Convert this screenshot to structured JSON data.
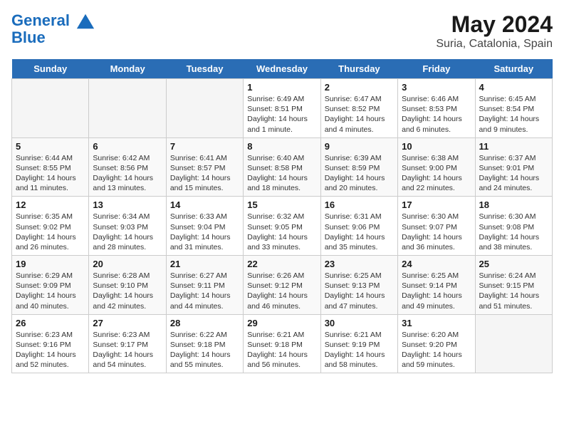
{
  "header": {
    "logo_line1": "General",
    "logo_line2": "Blue",
    "month": "May 2024",
    "location": "Suria, Catalonia, Spain"
  },
  "days_of_week": [
    "Sunday",
    "Monday",
    "Tuesday",
    "Wednesday",
    "Thursday",
    "Friday",
    "Saturday"
  ],
  "weeks": [
    [
      {
        "day": null
      },
      {
        "day": null
      },
      {
        "day": null
      },
      {
        "day": "1",
        "sunrise": "Sunrise: 6:49 AM",
        "sunset": "Sunset: 8:51 PM",
        "daylight": "Daylight: 14 hours and 1 minute."
      },
      {
        "day": "2",
        "sunrise": "Sunrise: 6:47 AM",
        "sunset": "Sunset: 8:52 PM",
        "daylight": "Daylight: 14 hours and 4 minutes."
      },
      {
        "day": "3",
        "sunrise": "Sunrise: 6:46 AM",
        "sunset": "Sunset: 8:53 PM",
        "daylight": "Daylight: 14 hours and 6 minutes."
      },
      {
        "day": "4",
        "sunrise": "Sunrise: 6:45 AM",
        "sunset": "Sunset: 8:54 PM",
        "daylight": "Daylight: 14 hours and 9 minutes."
      }
    ],
    [
      {
        "day": "5",
        "sunrise": "Sunrise: 6:44 AM",
        "sunset": "Sunset: 8:55 PM",
        "daylight": "Daylight: 14 hours and 11 minutes."
      },
      {
        "day": "6",
        "sunrise": "Sunrise: 6:42 AM",
        "sunset": "Sunset: 8:56 PM",
        "daylight": "Daylight: 14 hours and 13 minutes."
      },
      {
        "day": "7",
        "sunrise": "Sunrise: 6:41 AM",
        "sunset": "Sunset: 8:57 PM",
        "daylight": "Daylight: 14 hours and 15 minutes."
      },
      {
        "day": "8",
        "sunrise": "Sunrise: 6:40 AM",
        "sunset": "Sunset: 8:58 PM",
        "daylight": "Daylight: 14 hours and 18 minutes."
      },
      {
        "day": "9",
        "sunrise": "Sunrise: 6:39 AM",
        "sunset": "Sunset: 8:59 PM",
        "daylight": "Daylight: 14 hours and 20 minutes."
      },
      {
        "day": "10",
        "sunrise": "Sunrise: 6:38 AM",
        "sunset": "Sunset: 9:00 PM",
        "daylight": "Daylight: 14 hours and 22 minutes."
      },
      {
        "day": "11",
        "sunrise": "Sunrise: 6:37 AM",
        "sunset": "Sunset: 9:01 PM",
        "daylight": "Daylight: 14 hours and 24 minutes."
      }
    ],
    [
      {
        "day": "12",
        "sunrise": "Sunrise: 6:35 AM",
        "sunset": "Sunset: 9:02 PM",
        "daylight": "Daylight: 14 hours and 26 minutes."
      },
      {
        "day": "13",
        "sunrise": "Sunrise: 6:34 AM",
        "sunset": "Sunset: 9:03 PM",
        "daylight": "Daylight: 14 hours and 28 minutes."
      },
      {
        "day": "14",
        "sunrise": "Sunrise: 6:33 AM",
        "sunset": "Sunset: 9:04 PM",
        "daylight": "Daylight: 14 hours and 31 minutes."
      },
      {
        "day": "15",
        "sunrise": "Sunrise: 6:32 AM",
        "sunset": "Sunset: 9:05 PM",
        "daylight": "Daylight: 14 hours and 33 minutes."
      },
      {
        "day": "16",
        "sunrise": "Sunrise: 6:31 AM",
        "sunset": "Sunset: 9:06 PM",
        "daylight": "Daylight: 14 hours and 35 minutes."
      },
      {
        "day": "17",
        "sunrise": "Sunrise: 6:30 AM",
        "sunset": "Sunset: 9:07 PM",
        "daylight": "Daylight: 14 hours and 36 minutes."
      },
      {
        "day": "18",
        "sunrise": "Sunrise: 6:30 AM",
        "sunset": "Sunset: 9:08 PM",
        "daylight": "Daylight: 14 hours and 38 minutes."
      }
    ],
    [
      {
        "day": "19",
        "sunrise": "Sunrise: 6:29 AM",
        "sunset": "Sunset: 9:09 PM",
        "daylight": "Daylight: 14 hours and 40 minutes."
      },
      {
        "day": "20",
        "sunrise": "Sunrise: 6:28 AM",
        "sunset": "Sunset: 9:10 PM",
        "daylight": "Daylight: 14 hours and 42 minutes."
      },
      {
        "day": "21",
        "sunrise": "Sunrise: 6:27 AM",
        "sunset": "Sunset: 9:11 PM",
        "daylight": "Daylight: 14 hours and 44 minutes."
      },
      {
        "day": "22",
        "sunrise": "Sunrise: 6:26 AM",
        "sunset": "Sunset: 9:12 PM",
        "daylight": "Daylight: 14 hours and 46 minutes."
      },
      {
        "day": "23",
        "sunrise": "Sunrise: 6:25 AM",
        "sunset": "Sunset: 9:13 PM",
        "daylight": "Daylight: 14 hours and 47 minutes."
      },
      {
        "day": "24",
        "sunrise": "Sunrise: 6:25 AM",
        "sunset": "Sunset: 9:14 PM",
        "daylight": "Daylight: 14 hours and 49 minutes."
      },
      {
        "day": "25",
        "sunrise": "Sunrise: 6:24 AM",
        "sunset": "Sunset: 9:15 PM",
        "daylight": "Daylight: 14 hours and 51 minutes."
      }
    ],
    [
      {
        "day": "26",
        "sunrise": "Sunrise: 6:23 AM",
        "sunset": "Sunset: 9:16 PM",
        "daylight": "Daylight: 14 hours and 52 minutes."
      },
      {
        "day": "27",
        "sunrise": "Sunrise: 6:23 AM",
        "sunset": "Sunset: 9:17 PM",
        "daylight": "Daylight: 14 hours and 54 minutes."
      },
      {
        "day": "28",
        "sunrise": "Sunrise: 6:22 AM",
        "sunset": "Sunset: 9:18 PM",
        "daylight": "Daylight: 14 hours and 55 minutes."
      },
      {
        "day": "29",
        "sunrise": "Sunrise: 6:21 AM",
        "sunset": "Sunset: 9:18 PM",
        "daylight": "Daylight: 14 hours and 56 minutes."
      },
      {
        "day": "30",
        "sunrise": "Sunrise: 6:21 AM",
        "sunset": "Sunset: 9:19 PM",
        "daylight": "Daylight: 14 hours and 58 minutes."
      },
      {
        "day": "31",
        "sunrise": "Sunrise: 6:20 AM",
        "sunset": "Sunset: 9:20 PM",
        "daylight": "Daylight: 14 hours and 59 minutes."
      },
      {
        "day": null
      }
    ]
  ]
}
